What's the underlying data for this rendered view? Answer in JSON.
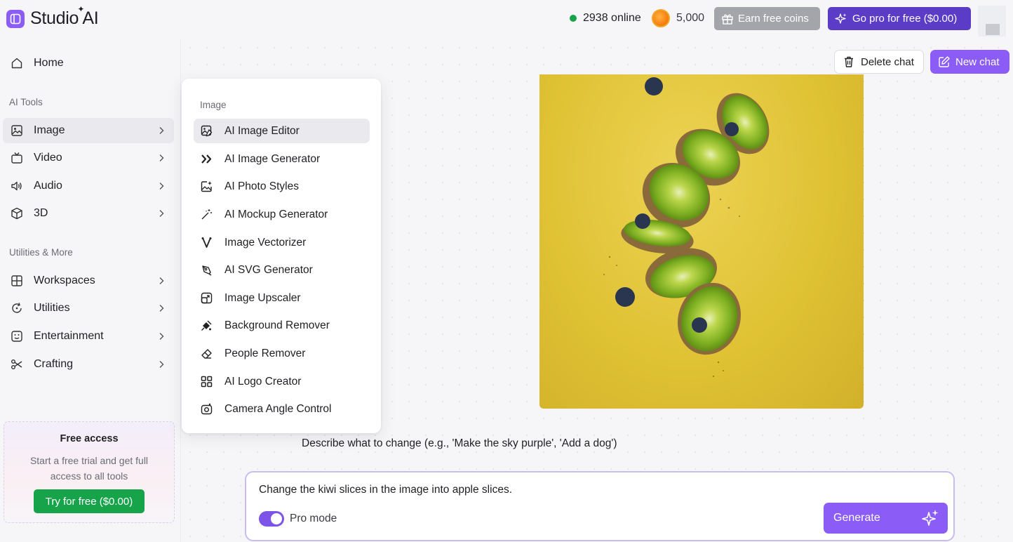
{
  "app": {
    "name": "Studio AI"
  },
  "header": {
    "online_count": "2938 online",
    "coins": "5,000",
    "earn_label": "Earn free coins",
    "gopro_label": "Go pro for free ($0.00)"
  },
  "sidebar": {
    "home": "Home",
    "ai_tools_label": "AI Tools",
    "tools": [
      {
        "label": "Image",
        "icon": "image-icon"
      },
      {
        "label": "Video",
        "icon": "tv-icon"
      },
      {
        "label": "Audio",
        "icon": "speaker-icon"
      },
      {
        "label": "3D",
        "icon": "cube-icon"
      }
    ],
    "utilities_label": "Utilities & More",
    "utilities": [
      {
        "label": "Workspaces",
        "icon": "grid-icon"
      },
      {
        "label": "Utilities",
        "icon": "refresh-icon"
      },
      {
        "label": "Entertainment",
        "icon": "smile-icon"
      },
      {
        "label": "Crafting",
        "icon": "scissors-icon"
      }
    ],
    "free_access": {
      "title": "Free access",
      "text": "Start a free trial and get full access to all tools",
      "button": "Try for free ($0.00)"
    }
  },
  "flyout": {
    "heading": "Image",
    "items": [
      {
        "label": "AI Image Editor",
        "icon": "image-edit-icon"
      },
      {
        "label": "AI Image Generator",
        "icon": "double-chevron-icon"
      },
      {
        "label": "AI Photo Styles",
        "icon": "image-sparkle-icon"
      },
      {
        "label": "AI Mockup Generator",
        "icon": "magic-wand-icon"
      },
      {
        "label": "Image Vectorizer",
        "icon": "vector-icon"
      },
      {
        "label": "AI SVG Generator",
        "icon": "pen-tool-icon"
      },
      {
        "label": "Image Upscaler",
        "icon": "upscale-icon"
      },
      {
        "label": "Background Remover",
        "icon": "bg-remove-icon"
      },
      {
        "label": "People Remover",
        "icon": "eraser-icon"
      },
      {
        "label": "AI Logo Creator",
        "icon": "logo-icon"
      },
      {
        "label": "Camera Angle Control",
        "icon": "camera-icon"
      }
    ]
  },
  "chat": {
    "delete_label": "Delete chat",
    "new_label": "New chat",
    "instruction": "Describe what to change (e.g., 'Make the sky purple', 'Add a dog')",
    "prompt": "Change the kiwi slices in the image into apple slices.",
    "pro_mode_label": "Pro mode",
    "pro_mode_enabled": true,
    "generate_label": "Generate"
  },
  "colors": {
    "accent": "#8b5cf6",
    "gopro": "#5a3cc6",
    "online": "#16a34a",
    "try_button": "#16a34a"
  }
}
